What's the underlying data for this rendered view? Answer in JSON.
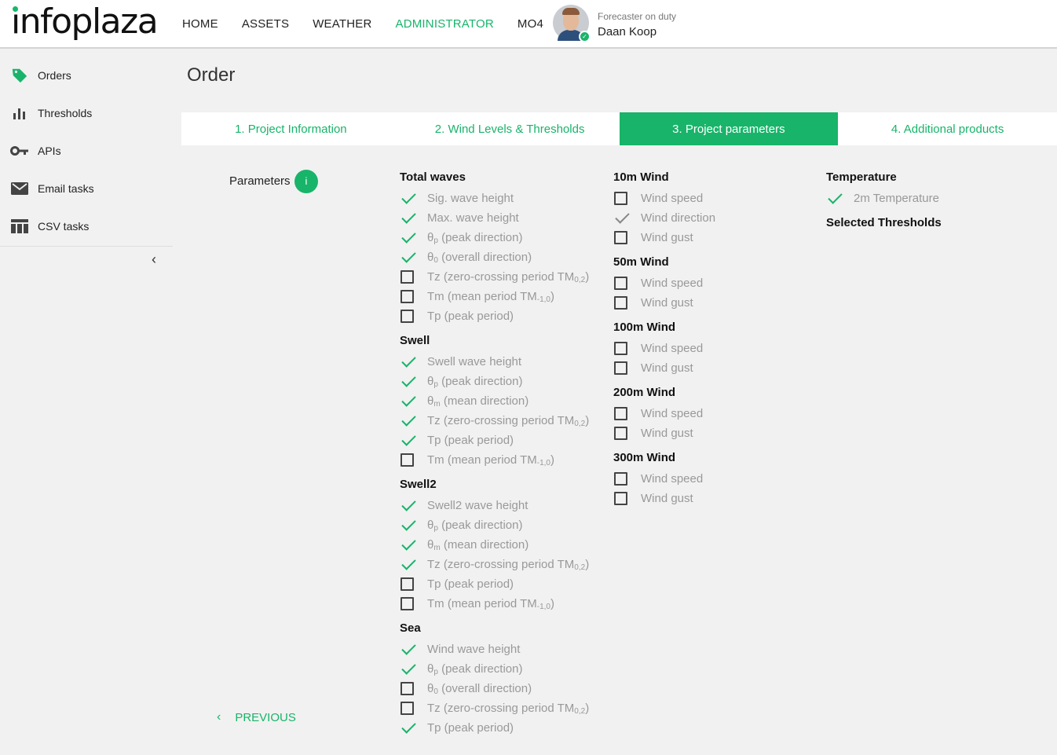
{
  "header": {
    "logo": "infoplaza",
    "nav": [
      {
        "label": "HOME",
        "active": false
      },
      {
        "label": "ASSETS",
        "active": false
      },
      {
        "label": "WEATHER",
        "active": false
      },
      {
        "label": "ADMINISTRATOR",
        "active": true
      },
      {
        "label": "MO4",
        "active": false
      }
    ],
    "duty_label": "Forecaster on duty",
    "duty_name": "Daan Koop"
  },
  "sidebar": {
    "items": [
      {
        "label": "Orders",
        "icon": "tag-icon"
      },
      {
        "label": "Thresholds",
        "icon": "bar-chart-icon"
      },
      {
        "label": "APIs",
        "icon": "key-icon"
      },
      {
        "label": "Email tasks",
        "icon": "mail-icon"
      },
      {
        "label": "CSV tasks",
        "icon": "table-icon"
      }
    ],
    "collapse_icon": "chevron-left-icon"
  },
  "main": {
    "title": "Order",
    "steps": [
      {
        "label": "1. Project Information",
        "active": false
      },
      {
        "label": "2. Wind Levels & Thresholds",
        "active": false
      },
      {
        "label": "3. Project parameters",
        "active": true
      },
      {
        "label": "4. Additional products",
        "active": false
      }
    ],
    "parameters_label": "Parameters",
    "info_badge": "i",
    "previous_label": "PREVIOUS"
  },
  "columns": [
    {
      "groups": [
        {
          "title": "Total waves",
          "items": [
            {
              "label": "Sig. wave height",
              "state": "checked"
            },
            {
              "label": "Max. wave height",
              "state": "checked"
            },
            {
              "label": "θp (peak direction)",
              "base": "θ",
              "sub": "p",
              "rest": " (peak direction)",
              "state": "checked"
            },
            {
              "label": "θ0 (overall direction)",
              "base": "θ",
              "sub": "0",
              "rest": " (overall direction)",
              "state": "checked"
            },
            {
              "label": "Tz (zero-crossing period TM0,2)",
              "base": "Tz (zero-crossing period TM",
              "sub": "0,2",
              "rest": ")",
              "state": "unchecked"
            },
            {
              "label": "Tm (mean period TM-1,0)",
              "base": "Tm (mean period TM",
              "sub": "-1,0",
              "rest": ")",
              "state": "unchecked"
            },
            {
              "label": "Tp (peak period)",
              "state": "unchecked"
            }
          ]
        },
        {
          "title": "Swell",
          "items": [
            {
              "label": "Swell wave height",
              "state": "checked"
            },
            {
              "label": "θp (peak direction)",
              "base": "θ",
              "sub": "p",
              "rest": " (peak direction)",
              "state": "checked"
            },
            {
              "label": "θm (mean direction)",
              "base": "θ",
              "sub": "m",
              "rest": " (mean direction)",
              "state": "checked"
            },
            {
              "label": "Tz (zero-crossing period TM0,2)",
              "base": "Tz (zero-crossing period TM",
              "sub": "0,2",
              "rest": ")",
              "state": "checked"
            },
            {
              "label": "Tp (peak period)",
              "state": "checked"
            },
            {
              "label": "Tm (mean period TM-1,0)",
              "base": "Tm (mean period TM",
              "sub": "-1,0",
              "rest": ")",
              "state": "unchecked"
            }
          ]
        },
        {
          "title": "Swell2",
          "items": [
            {
              "label": "Swell2 wave height",
              "state": "checked"
            },
            {
              "label": "θp (peak direction)",
              "base": "θ",
              "sub": "p",
              "rest": " (peak direction)",
              "state": "checked"
            },
            {
              "label": "θm (mean direction)",
              "base": "θ",
              "sub": "m",
              "rest": " (mean direction)",
              "state": "checked"
            },
            {
              "label": "Tz (zero-crossing period TM0,2)",
              "base": "Tz (zero-crossing period TM",
              "sub": "0,2",
              "rest": ")",
              "state": "checked"
            },
            {
              "label": "Tp (peak period)",
              "state": "unchecked"
            },
            {
              "label": "Tm (mean period TM-1,0)",
              "base": "Tm (mean period TM",
              "sub": "-1,0",
              "rest": ")",
              "state": "unchecked"
            }
          ]
        },
        {
          "title": "Sea",
          "items": [
            {
              "label": "Wind wave height",
              "state": "checked"
            },
            {
              "label": "θp (peak direction)",
              "base": "θ",
              "sub": "p",
              "rest": " (peak direction)",
              "state": "checked"
            },
            {
              "label": "θ0 (overall direction)",
              "base": "θ",
              "sub": "0",
              "rest": " (overall direction)",
              "state": "unchecked"
            },
            {
              "label": "Tz (zero-crossing period TM0,2)",
              "base": "Tz (zero-crossing period TM",
              "sub": "0,2",
              "rest": ")",
              "state": "unchecked"
            },
            {
              "label": "Tp (peak period)",
              "state": "checked"
            }
          ]
        }
      ]
    },
    {
      "groups": [
        {
          "title": "10m Wind",
          "items": [
            {
              "label": "Wind speed",
              "state": "unchecked"
            },
            {
              "label": "Wind direction",
              "state": "checked-grey"
            },
            {
              "label": "Wind gust",
              "state": "unchecked"
            }
          ]
        },
        {
          "title": "50m Wind",
          "items": [
            {
              "label": "Wind speed",
              "state": "unchecked"
            },
            {
              "label": "Wind gust",
              "state": "unchecked"
            }
          ]
        },
        {
          "title": "100m Wind",
          "items": [
            {
              "label": "Wind speed",
              "state": "unchecked"
            },
            {
              "label": "Wind gust",
              "state": "unchecked"
            }
          ]
        },
        {
          "title": "200m Wind",
          "items": [
            {
              "label": "Wind speed",
              "state": "unchecked"
            },
            {
              "label": "Wind gust",
              "state": "unchecked"
            }
          ]
        },
        {
          "title": "300m Wind",
          "items": [
            {
              "label": "Wind speed",
              "state": "unchecked"
            },
            {
              "label": "Wind gust",
              "state": "unchecked"
            }
          ]
        }
      ]
    },
    {
      "groups": [
        {
          "title": "Temperature",
          "items": [
            {
              "label": "2m Temperature",
              "state": "checked"
            }
          ]
        },
        {
          "title": "Selected Thresholds",
          "items": []
        }
      ]
    }
  ],
  "colors": {
    "accent": "#18b46a",
    "text": "#222222",
    "muted": "#999999",
    "background": "#f1f1f1"
  }
}
